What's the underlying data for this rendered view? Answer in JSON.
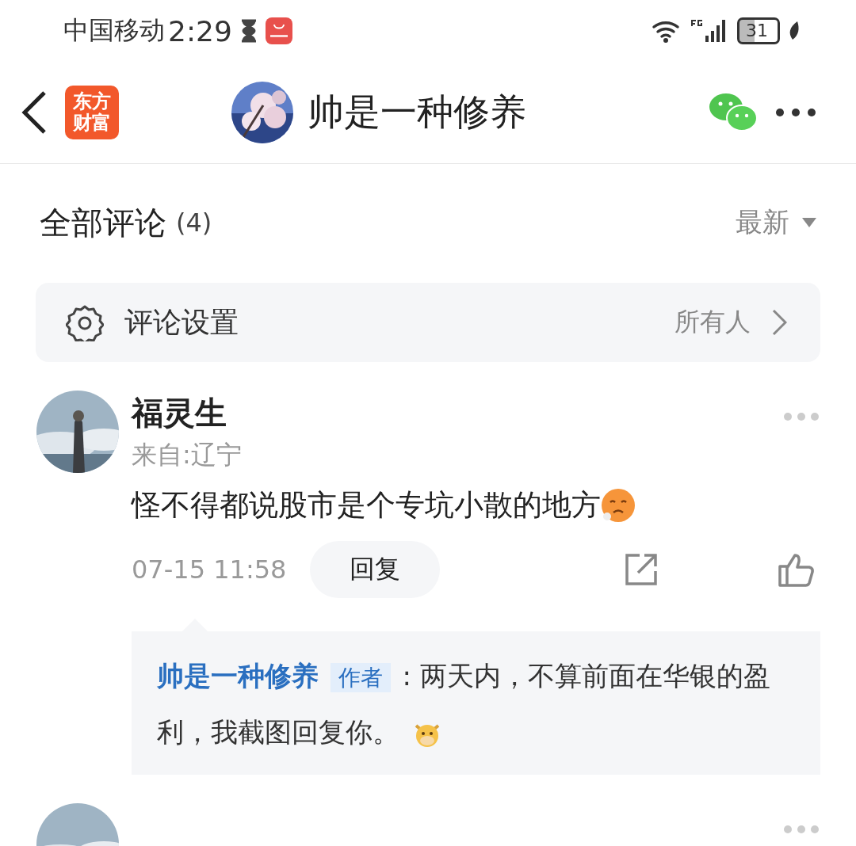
{
  "status_bar": {
    "carrier": "中国移动",
    "time": "2:29",
    "battery": "31"
  },
  "nav": {
    "logo_lines": [
      "东方",
      "财富"
    ],
    "title": "帅是一种修养"
  },
  "comments_header": {
    "title": "全部评论",
    "count": "(4)",
    "sort": "最新"
  },
  "settings": {
    "label": "评论设置",
    "value": "所有人"
  },
  "comments": [
    {
      "avatar": {
        "kind": "picture"
      },
      "name": "福灵生",
      "location": "来自:辽宁",
      "text": "怪不得都说股市是个专坑小散的地方",
      "time": "07-15 11:58",
      "reply_button": "回复",
      "replies": [
        {
          "author": "帅是一种修养",
          "badge": "作者",
          "text": ": 两天内，不算前面在华银的盈利，我截图回复你。"
        }
      ]
    },
    {
      "avatar": {
        "kind": "picture"
      }
    }
  ]
}
